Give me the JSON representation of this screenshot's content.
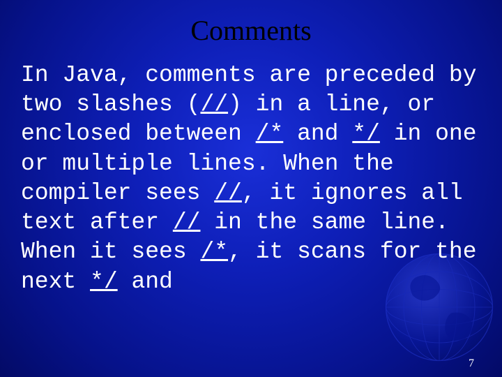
{
  "slide": {
    "title": "Comments",
    "page_number": "7",
    "body": {
      "segments": [
        {
          "t": "In Java, comments are preceded by two slashes (",
          "u": false
        },
        {
          "t": "//",
          "u": true
        },
        {
          "t": ") in a line, or enclosed between ",
          "u": false
        },
        {
          "t": "/*",
          "u": true
        },
        {
          "t": " and ",
          "u": false
        },
        {
          "t": "*/",
          "u": true
        },
        {
          "t": " in one or multiple lines. When the compiler sees ",
          "u": false
        },
        {
          "t": "//",
          "u": true
        },
        {
          "t": ", it ignores all text after ",
          "u": false
        },
        {
          "t": "//",
          "u": true
        },
        {
          "t": " in the same line. When it sees ",
          "u": false
        },
        {
          "t": "/*",
          "u": true
        },
        {
          "t": ", it scans for the next ",
          "u": false
        },
        {
          "t": "*/",
          "u": true
        },
        {
          "t": " and",
          "u": false
        }
      ]
    }
  }
}
